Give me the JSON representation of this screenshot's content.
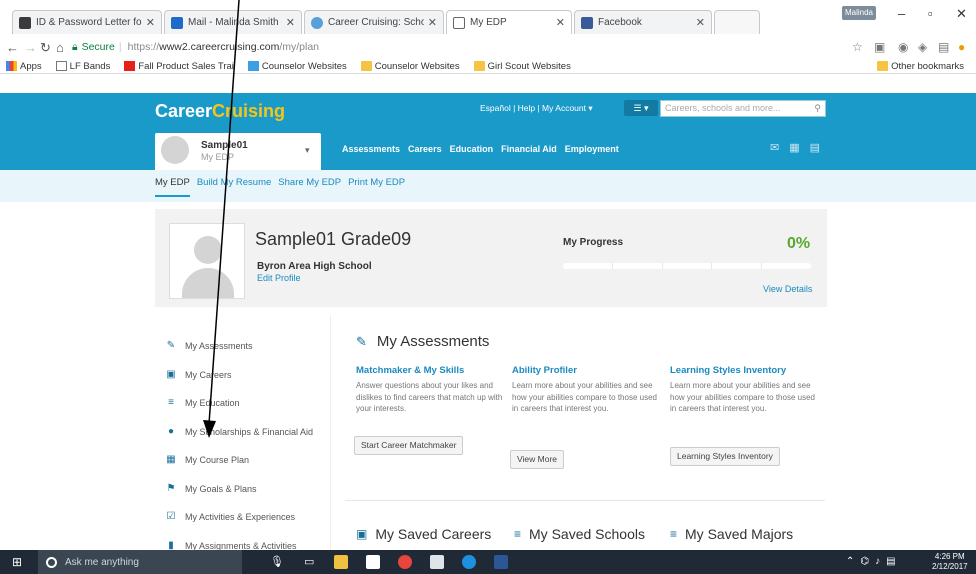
{
  "browser": {
    "tabs": [
      {
        "title": "ID & Password Letter for",
        "icon": "letter-icon",
        "color": "#3b3b3b"
      },
      {
        "title": "Mail - Malinda Smith - O",
        "icon": "mail-icon",
        "color": "#1e6cc7"
      },
      {
        "title": "Career Cruising: School I",
        "icon": "globe-icon",
        "color": "#5aa0d8"
      },
      {
        "title": "My EDP",
        "icon": "page-icon",
        "color": "#666666"
      },
      {
        "title": "Facebook",
        "icon": "facebook-icon",
        "color": "#3b5998"
      }
    ],
    "user_badge": "Malinda",
    "secure_label": "Secure",
    "url_scheme": "https://",
    "url_host": "www2.careercruising.com",
    "url_path": "/my/plan",
    "bookmarks": [
      "Apps",
      "LF Bands",
      "Fall Product Sales Trai",
      "Counselor Websites",
      "Counselor Websites",
      "Girl Scout Websites"
    ],
    "other_bookmarks": "Other bookmarks"
  },
  "site": {
    "logo_a": "Career",
    "logo_b": "Cruising",
    "toplinks": "Español  |  Help  |  My Account  ▾",
    "menu_label": "☰ ▾",
    "search_placeholder": "Careers, schools and more...",
    "user_name": "Sample01",
    "user_sub": "My EDP",
    "nav": [
      "Assessments",
      "Careers",
      "Education",
      "Financial Aid",
      "Employment"
    ],
    "subnav": [
      "My EDP",
      "Build My Resume",
      "Share My EDP",
      "Print My EDP"
    ]
  },
  "profile": {
    "name": "Sample01 Grade09",
    "school": "Byron Area High School",
    "edit": "Edit Profile",
    "progress_label": "My Progress",
    "progress_text": "0%",
    "progress_fraction": 0,
    "view_details": "View Details"
  },
  "sidebar": [
    {
      "label": "My Assessments",
      "icon": "pencil-icon",
      "glyph": "✎"
    },
    {
      "label": "My Careers",
      "icon": "briefcase-icon",
      "glyph": "▣"
    },
    {
      "label": "My Education",
      "icon": "school-icon",
      "glyph": "≡"
    },
    {
      "label": "My Scholarships & Financial Aid",
      "icon": "money-icon",
      "glyph": "●"
    },
    {
      "label": "My Course Plan",
      "icon": "grid-icon",
      "glyph": "▦"
    },
    {
      "label": "My Goals & Plans",
      "icon": "flag-icon",
      "glyph": "⚑"
    },
    {
      "label": "My Activities & Experiences",
      "icon": "edit-box-icon",
      "glyph": "☑"
    },
    {
      "label": "My Assignments & Activities",
      "icon": "lock-icon",
      "glyph": "▮"
    }
  ],
  "main": {
    "heading": "My Assessments",
    "columns": [
      {
        "title": "Matchmaker & My Skills",
        "text": "Answer questions about your likes and dislikes to find careers that match up with your interests.",
        "button": "Start Career Matchmaker"
      },
      {
        "title": "Ability Profiler",
        "text": "Learn more about your abilities and see how your abilities compare to those used in careers that interest you.",
        "button": "View More"
      },
      {
        "title": "Learning Styles Inventory",
        "text": "Learn more about your abilities and see how your abilities compare to those used in careers that interest you.",
        "button": "Learning Styles Inventory"
      }
    ],
    "saved": [
      "My Saved Careers",
      "My Saved Schools",
      "My Saved Majors"
    ]
  },
  "taskbar": {
    "search_placeholder": "Ask me anything",
    "time": "4:26 PM",
    "date": "2/12/2017"
  }
}
